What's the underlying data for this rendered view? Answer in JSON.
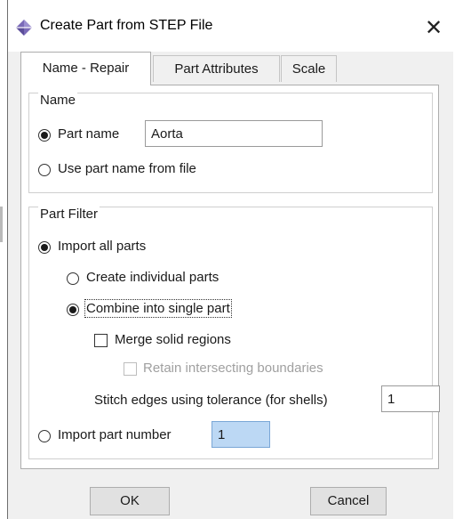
{
  "window": {
    "title": "Create Part from STEP File",
    "close_glyph": "✕"
  },
  "tabs": [
    {
      "label": "Name - Repair",
      "active": true
    },
    {
      "label": "Part Attributes",
      "active": false
    },
    {
      "label": "Scale",
      "active": false
    }
  ],
  "name_group": {
    "title": "Name",
    "part_name_label": "Part name",
    "part_name_value": "Aorta",
    "use_file_name_label": "Use part name from file"
  },
  "filter_group": {
    "title": "Part Filter",
    "import_all_label": "Import all parts",
    "create_individual_label": "Create individual parts",
    "combine_label": "Combine into single part",
    "merge_label": "Merge solid regions",
    "retain_label": "Retain intersecting boundaries",
    "stitch_label": "Stitch edges using tolerance (for shells)",
    "stitch_value": "1",
    "import_number_label": "Import part number",
    "import_number_value": "1"
  },
  "buttons": {
    "ok": "OK",
    "cancel": "Cancel"
  },
  "colors": {
    "accent": "#bcd8f4",
    "icon": "#7a6ab8"
  },
  "icons": {
    "title": "abaqus-part-icon"
  }
}
